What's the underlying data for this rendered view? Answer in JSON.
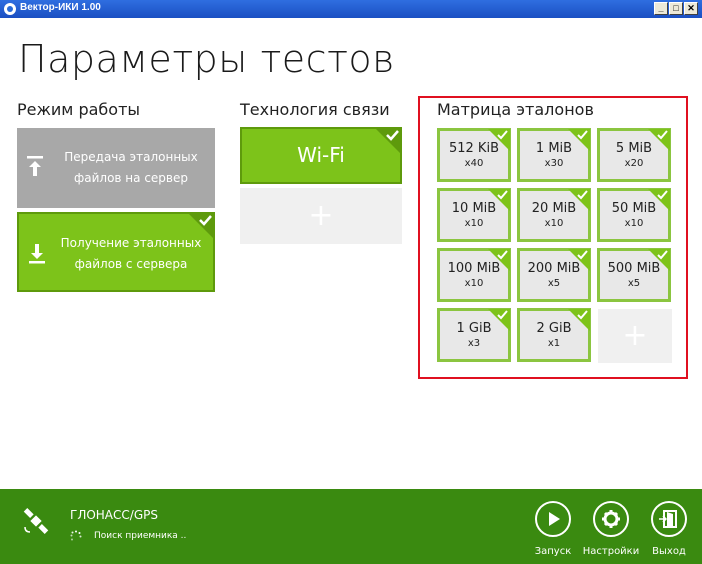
{
  "window": {
    "title": "Вектор-ИКИ 1.00",
    "min": "_",
    "max": "□",
    "close": "✕"
  },
  "page_title": "Параметры тестов",
  "mode": {
    "title": "Режим работы",
    "upload": "Передача эталонных файлов на сервер",
    "download": "Получение эталонных файлов с сервера"
  },
  "tech": {
    "title": "Технология связи",
    "wifi": "Wi-Fi",
    "add": "+"
  },
  "matrix": {
    "title": "Матрица эталонов",
    "items": [
      {
        "size": "512 KiB",
        "count": "x40"
      },
      {
        "size": "1 MiB",
        "count": "x30"
      },
      {
        "size": "5 MiB",
        "count": "x20"
      },
      {
        "size": "10 MiB",
        "count": "x10"
      },
      {
        "size": "20 MiB",
        "count": "x10"
      },
      {
        "size": "50 MiB",
        "count": "x10"
      },
      {
        "size": "100 MiB",
        "count": "x10"
      },
      {
        "size": "200 MiB",
        "count": "x5"
      },
      {
        "size": "500 MiB",
        "count": "x5"
      },
      {
        "size": "1 GiB",
        "count": "x3"
      },
      {
        "size": "2 GiB",
        "count": "x1"
      }
    ],
    "add": "+"
  },
  "footer": {
    "gps_title": "ГЛОНАСС/GPS",
    "gps_status": "Поиск приемника ..",
    "start": "Запуск",
    "settings": "Настройки",
    "exit": "Выход"
  }
}
